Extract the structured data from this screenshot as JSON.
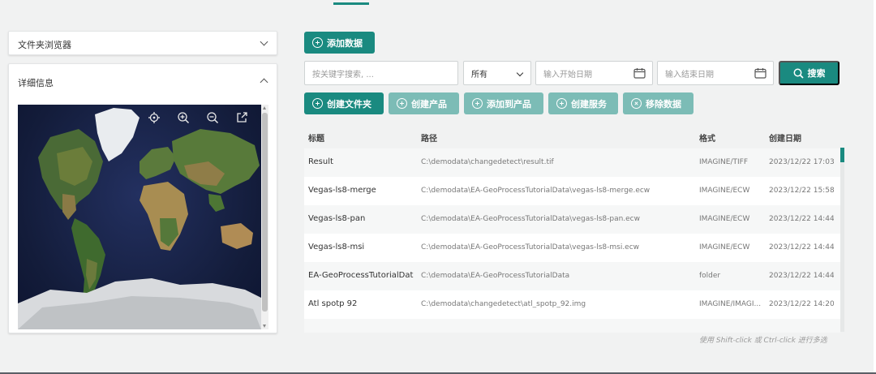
{
  "left": {
    "folder_browser": {
      "title": "文件夹浏览器"
    },
    "detail": {
      "title": "详细信息"
    },
    "map_tools": [
      "locate-icon",
      "zoom-in-icon",
      "zoom-out-icon",
      "open-external-icon"
    ]
  },
  "toolbar": {
    "add_data": "添加数据",
    "create_folder": "创建文件夹",
    "create_product": "创建产品",
    "add_to_product": "添加到产品",
    "create_service": "创建服务",
    "remove_data": "移除数据",
    "search": "搜索"
  },
  "filters": {
    "keyword_placeholder": "按关键字搜索, ...",
    "type_selected": "所有",
    "start_date_placeholder": "输入开始日期",
    "end_date_placeholder": "输入结束日期"
  },
  "table": {
    "headers": [
      "标题",
      "路径",
      "格式",
      "创建日期"
    ],
    "rows": [
      {
        "title": "Result",
        "path": "C:\\demodata\\changedetect\\result.tif",
        "format": "IMAGINE/TIFF",
        "date": "2023/12/22 17:03"
      },
      {
        "title": "Vegas-ls8-merge",
        "path": "C:\\demodata\\EA-GeoProcessTutorialData\\vegas-ls8-merge.ecw",
        "format": "IMAGINE/ECW",
        "date": "2023/12/22 15:58"
      },
      {
        "title": "Vegas-ls8-pan",
        "path": "C:\\demodata\\EA-GeoProcessTutorialData\\vegas-ls8-pan.ecw",
        "format": "IMAGINE/ECW",
        "date": "2023/12/22 14:44"
      },
      {
        "title": "Vegas-ls8-msi",
        "path": "C:\\demodata\\EA-GeoProcessTutorialData\\vegas-ls8-msi.ecw",
        "format": "IMAGINE/ECW",
        "date": "2023/12/22 14:44"
      },
      {
        "title": "EA-GeoProcessTutorialData",
        "path": "C:\\demodata\\EA-GeoProcessTutorialData",
        "format": "folder",
        "date": "2023/12/22 14:44"
      },
      {
        "title": "Atl spotp 92",
        "path": "C:\\demodata\\changedetect\\atl_spotp_92.img",
        "format": "IMAGINE/IMAGI...",
        "date": "2023/12/22 14:20"
      }
    ]
  },
  "hint": "使用 Shift-click 或 Ctrl-click 进行多选",
  "colors": {
    "accent": "#1a8a80",
    "accent_disabled": "#7cbcb6",
    "background": "#f1f2f2"
  }
}
